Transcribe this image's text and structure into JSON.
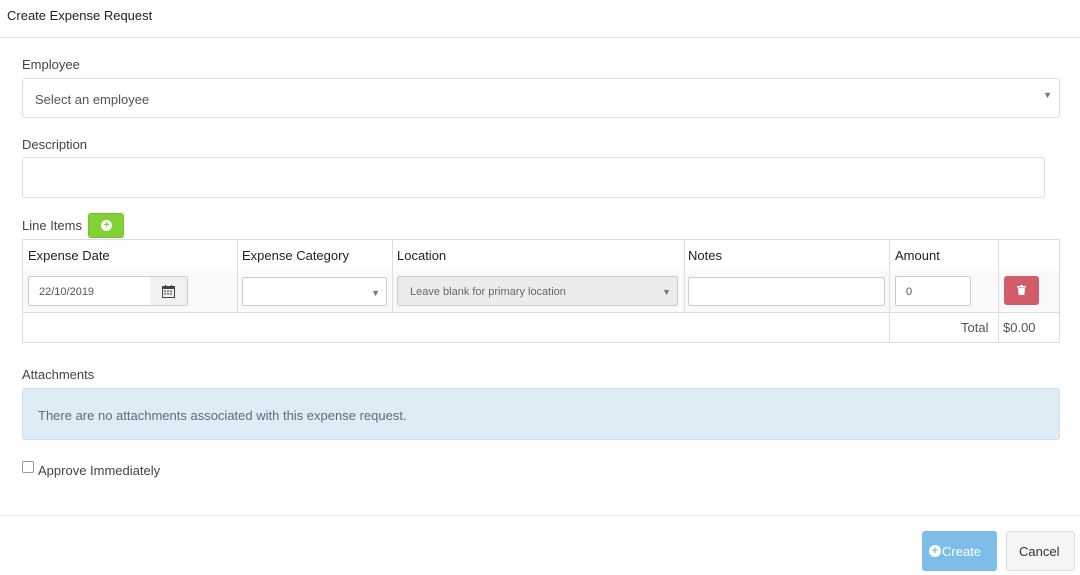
{
  "dialog": {
    "title": "Create Expense Request"
  },
  "employee": {
    "label": "Employee",
    "placeholder": "Select an employee"
  },
  "description": {
    "label": "Description",
    "value": ""
  },
  "line_items": {
    "label": "Line Items",
    "columns": [
      "Expense Date",
      "Expense Category",
      "Location",
      "Notes",
      "Amount"
    ],
    "rows": [
      {
        "expense_date": "22/10/2019",
        "expense_category": "",
        "location_placeholder": "Leave blank for primary location",
        "notes": "",
        "amount": "0"
      }
    ],
    "total_label": "Total",
    "total_value": "$0.00"
  },
  "attachments": {
    "label": "Attachments",
    "empty_message": "There are no attachments associated with this expense request."
  },
  "approve": {
    "label": "Approve Immediately",
    "checked": false
  },
  "footer": {
    "create_label": "Create",
    "cancel_label": "Cancel"
  },
  "colors": {
    "add_green": "#82d136",
    "delete_red": "#d25c6a",
    "create_blue": "#7cbdea",
    "alert_bg": "#deecf6"
  },
  "icons": [
    "plus-circle-icon",
    "calendar-icon",
    "trash-icon",
    "caret-down-icon"
  ]
}
